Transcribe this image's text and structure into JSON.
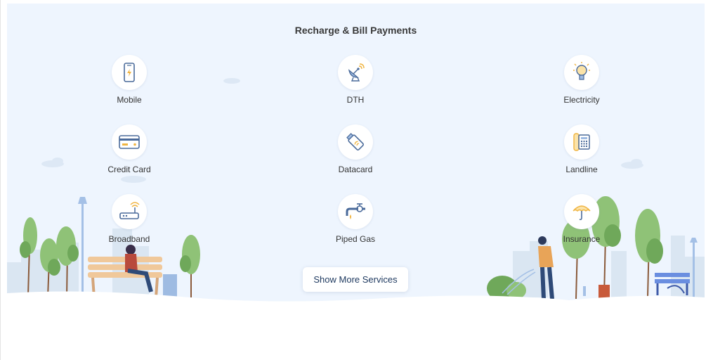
{
  "section": {
    "title": "Recharge & Bill Payments"
  },
  "services": [
    {
      "label": "Mobile",
      "icon": "mobile-phone-icon"
    },
    {
      "label": "DTH",
      "icon": "satellite-dish-icon"
    },
    {
      "label": "Electricity",
      "icon": "light-bulb-icon"
    },
    {
      "label": "Credit Card",
      "icon": "credit-card-icon"
    },
    {
      "label": "Datacard",
      "icon": "usb-datacard-icon"
    },
    {
      "label": "Landline",
      "icon": "landline-phone-icon"
    },
    {
      "label": "Broadband",
      "icon": "wifi-router-icon"
    },
    {
      "label": "Piped Gas",
      "icon": "gas-pipe-icon"
    },
    {
      "label": "Insurance",
      "icon": "umbrella-icon"
    }
  ],
  "actions": {
    "show_more_label": "Show More Services"
  },
  "colors": {
    "panel_bg": "#eef5fe",
    "icon_blue": "#4a6a9a",
    "icon_accent": "#f0b440",
    "tree_green": "#8fc277"
  }
}
